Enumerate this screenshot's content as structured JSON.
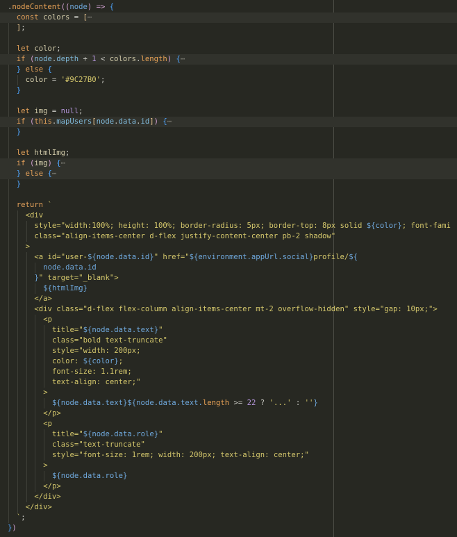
{
  "editor": {
    "lines": [
      {
        "indent": 0,
        "hl": false,
        "tokens": [
          {
            "t": ".",
            "c": "punc"
          },
          {
            "t": "nodeContent",
            "c": "fn"
          },
          {
            "t": "((",
            "c": "paren"
          },
          {
            "t": "node",
            "c": "param"
          },
          {
            "t": ") => ",
            "c": "paren"
          },
          {
            "t": "{",
            "c": "brace"
          }
        ]
      },
      {
        "indent": 1,
        "hl": true,
        "tokens": [
          {
            "t": "const ",
            "c": "kw"
          },
          {
            "t": "colors",
            "c": "var"
          },
          {
            "t": " = ",
            "c": "op"
          },
          {
            "t": "[",
            "c": "bracket"
          },
          {
            "t": "⋯",
            "c": "fold"
          }
        ]
      },
      {
        "indent": 1,
        "hl": false,
        "tokens": [
          {
            "t": "]",
            "c": "bracket"
          },
          {
            "t": ";",
            "c": "punc"
          }
        ]
      },
      {
        "indent": 1,
        "hl": false,
        "tokens": []
      },
      {
        "indent": 1,
        "hl": false,
        "tokens": [
          {
            "t": "let ",
            "c": "kw"
          },
          {
            "t": "color",
            "c": "var"
          },
          {
            "t": ";",
            "c": "punc"
          }
        ]
      },
      {
        "indent": 1,
        "hl": true,
        "tokens": [
          {
            "t": "if ",
            "c": "kw"
          },
          {
            "t": "(",
            "c": "paren"
          },
          {
            "t": "node",
            "c": "prop"
          },
          {
            "t": ".",
            "c": "punc"
          },
          {
            "t": "depth",
            "c": "prop"
          },
          {
            "t": " + ",
            "c": "op"
          },
          {
            "t": "1",
            "c": "num"
          },
          {
            "t": " < ",
            "c": "op"
          },
          {
            "t": "colors",
            "c": "var"
          },
          {
            "t": ".",
            "c": "punc"
          },
          {
            "t": "length",
            "c": "fn"
          },
          {
            "t": ") ",
            "c": "paren"
          },
          {
            "t": "{",
            "c": "brace"
          },
          {
            "t": "⋯",
            "c": "fold"
          }
        ]
      },
      {
        "indent": 1,
        "hl": false,
        "tokens": [
          {
            "t": "} ",
            "c": "brace"
          },
          {
            "t": "else ",
            "c": "kw"
          },
          {
            "t": "{",
            "c": "brace"
          }
        ]
      },
      {
        "indent": 2,
        "hl": false,
        "tokens": [
          {
            "t": "color",
            "c": "var"
          },
          {
            "t": " = ",
            "c": "op"
          },
          {
            "t": "'#9C27B0'",
            "c": "str"
          },
          {
            "t": ";",
            "c": "punc"
          }
        ]
      },
      {
        "indent": 1,
        "hl": false,
        "tokens": [
          {
            "t": "}",
            "c": "brace"
          }
        ]
      },
      {
        "indent": 1,
        "hl": false,
        "tokens": []
      },
      {
        "indent": 1,
        "hl": false,
        "tokens": [
          {
            "t": "let ",
            "c": "kw"
          },
          {
            "t": "img",
            "c": "var"
          },
          {
            "t": " = ",
            "c": "op"
          },
          {
            "t": "null",
            "c": "num"
          },
          {
            "t": ";",
            "c": "punc"
          }
        ]
      },
      {
        "indent": 1,
        "hl": true,
        "tokens": [
          {
            "t": "if ",
            "c": "kw"
          },
          {
            "t": "(",
            "c": "paren"
          },
          {
            "t": "this",
            "c": "kw"
          },
          {
            "t": ".",
            "c": "punc"
          },
          {
            "t": "mapUsers",
            "c": "prop"
          },
          {
            "t": "[",
            "c": "bracket"
          },
          {
            "t": "node",
            "c": "prop"
          },
          {
            "t": ".",
            "c": "punc"
          },
          {
            "t": "data",
            "c": "prop"
          },
          {
            "t": ".",
            "c": "punc"
          },
          {
            "t": "id",
            "c": "prop"
          },
          {
            "t": "]",
            "c": "bracket"
          },
          {
            "t": ") ",
            "c": "paren"
          },
          {
            "t": "{",
            "c": "brace"
          },
          {
            "t": "⋯",
            "c": "fold"
          }
        ]
      },
      {
        "indent": 1,
        "hl": false,
        "tokens": [
          {
            "t": "}",
            "c": "brace"
          }
        ]
      },
      {
        "indent": 1,
        "hl": false,
        "tokens": []
      },
      {
        "indent": 1,
        "hl": false,
        "tokens": [
          {
            "t": "let ",
            "c": "kw"
          },
          {
            "t": "htmlImg",
            "c": "var"
          },
          {
            "t": ";",
            "c": "punc"
          }
        ]
      },
      {
        "indent": 1,
        "hl": true,
        "tokens": [
          {
            "t": "if ",
            "c": "kw"
          },
          {
            "t": "(",
            "c": "paren"
          },
          {
            "t": "img",
            "c": "var"
          },
          {
            "t": ") ",
            "c": "paren"
          },
          {
            "t": "{",
            "c": "brace"
          },
          {
            "t": "⋯",
            "c": "fold"
          }
        ]
      },
      {
        "indent": 1,
        "hl": true,
        "tokens": [
          {
            "t": "} ",
            "c": "brace"
          },
          {
            "t": "else ",
            "c": "kw"
          },
          {
            "t": "{",
            "c": "brace"
          },
          {
            "t": "⋯",
            "c": "fold"
          }
        ]
      },
      {
        "indent": 1,
        "hl": false,
        "tokens": [
          {
            "t": "}",
            "c": "brace"
          }
        ]
      },
      {
        "indent": 1,
        "hl": false,
        "tokens": []
      },
      {
        "indent": 1,
        "hl": false,
        "tokens": [
          {
            "t": "return ",
            "c": "kw"
          },
          {
            "t": "`",
            "c": "str"
          }
        ]
      },
      {
        "indent": 2,
        "hl": false,
        "tokens": [
          {
            "t": "<div",
            "c": "str"
          }
        ]
      },
      {
        "indent": 3,
        "hl": false,
        "tokens": [
          {
            "t": "style=\"width:100%; height: 100%; border-radius: 5px; border-top: 8px solid ",
            "c": "str"
          },
          {
            "t": "${color}",
            "c": "interp"
          },
          {
            "t": "; font-fami",
            "c": "str"
          }
        ]
      },
      {
        "indent": 3,
        "hl": false,
        "tokens": [
          {
            "t": "class=\"align-items-center d-flex justify-content-center pb-2 shadow\"",
            "c": "str"
          }
        ]
      },
      {
        "indent": 2,
        "hl": false,
        "tokens": [
          {
            "t": ">",
            "c": "str"
          }
        ]
      },
      {
        "indent": 3,
        "hl": false,
        "tokens": [
          {
            "t": "<a id=\"user-",
            "c": "str"
          },
          {
            "t": "${node.data.id}",
            "c": "interp"
          },
          {
            "t": "\" href=\"",
            "c": "str"
          },
          {
            "t": "${environment.appUrl.social}",
            "c": "interp"
          },
          {
            "t": "profile/",
            "c": "str"
          },
          {
            "t": "${",
            "c": "interp"
          }
        ]
      },
      {
        "indent": 4,
        "hl": false,
        "tokens": [
          {
            "t": "node.data.id",
            "c": "interp"
          }
        ]
      },
      {
        "indent": 3,
        "hl": false,
        "tokens": [
          {
            "t": "}",
            "c": "interp"
          },
          {
            "t": "\" target=\"_blank\">",
            "c": "str"
          }
        ]
      },
      {
        "indent": 4,
        "hl": false,
        "tokens": [
          {
            "t": "${htmlImg}",
            "c": "interp"
          }
        ]
      },
      {
        "indent": 3,
        "hl": false,
        "tokens": [
          {
            "t": "</a>",
            "c": "str"
          }
        ]
      },
      {
        "indent": 3,
        "hl": false,
        "tokens": [
          {
            "t": "<div class=\"d-flex flex-column align-items-center mt-2 overflow-hidden\" style=\"gap: 10px;\">",
            "c": "str"
          }
        ]
      },
      {
        "indent": 4,
        "hl": false,
        "tokens": [
          {
            "t": "<p",
            "c": "str"
          }
        ]
      },
      {
        "indent": 5,
        "hl": false,
        "tokens": [
          {
            "t": "title=\"",
            "c": "str"
          },
          {
            "t": "${node.data.text}",
            "c": "interp"
          },
          {
            "t": "\"",
            "c": "str"
          }
        ]
      },
      {
        "indent": 5,
        "hl": false,
        "tokens": [
          {
            "t": "class=\"bold text-truncate\"",
            "c": "str"
          }
        ]
      },
      {
        "indent": 5,
        "hl": false,
        "tokens": [
          {
            "t": "style=\"width: 200px;",
            "c": "str"
          }
        ]
      },
      {
        "indent": 5,
        "hl": false,
        "tokens": [
          {
            "t": "color: ",
            "c": "str"
          },
          {
            "t": "${color}",
            "c": "interp"
          },
          {
            "t": ";",
            "c": "str"
          }
        ]
      },
      {
        "indent": 5,
        "hl": false,
        "tokens": [
          {
            "t": "font-size: 1.1rem;",
            "c": "str"
          }
        ]
      },
      {
        "indent": 5,
        "hl": false,
        "tokens": [
          {
            "t": "text-align: center;\"",
            "c": "str"
          }
        ]
      },
      {
        "indent": 4,
        "hl": false,
        "tokens": [
          {
            "t": ">",
            "c": "str"
          }
        ]
      },
      {
        "indent": 5,
        "hl": false,
        "tokens": [
          {
            "t": "${node.data.text}${node.data.text.",
            "c": "interp"
          },
          {
            "t": "length",
            "c": "fn"
          },
          {
            "t": " >= ",
            "c": "op"
          },
          {
            "t": "22",
            "c": "num"
          },
          {
            "t": " ? ",
            "c": "op"
          },
          {
            "t": "'...'",
            "c": "str"
          },
          {
            "t": " : ",
            "c": "op"
          },
          {
            "t": "''",
            "c": "str"
          },
          {
            "t": "}",
            "c": "interp"
          }
        ]
      },
      {
        "indent": 4,
        "hl": false,
        "tokens": [
          {
            "t": "</p>",
            "c": "str"
          }
        ]
      },
      {
        "indent": 4,
        "hl": false,
        "tokens": [
          {
            "t": "<p",
            "c": "str"
          }
        ]
      },
      {
        "indent": 5,
        "hl": false,
        "tokens": [
          {
            "t": "title=\"",
            "c": "str"
          },
          {
            "t": "${node.data.role}",
            "c": "interp"
          },
          {
            "t": "\"",
            "c": "str"
          }
        ]
      },
      {
        "indent": 5,
        "hl": false,
        "tokens": [
          {
            "t": "class=\"text-truncate\"",
            "c": "str"
          }
        ]
      },
      {
        "indent": 5,
        "hl": false,
        "tokens": [
          {
            "t": "style=\"font-size: 1rem; width: 200px; text-align: center;\"",
            "c": "str"
          }
        ]
      },
      {
        "indent": 4,
        "hl": false,
        "tokens": [
          {
            "t": ">",
            "c": "str"
          }
        ]
      },
      {
        "indent": 5,
        "hl": false,
        "tokens": [
          {
            "t": "${node.data.role}",
            "c": "interp"
          }
        ]
      },
      {
        "indent": 4,
        "hl": false,
        "tokens": [
          {
            "t": "</p>",
            "c": "str"
          }
        ]
      },
      {
        "indent": 3,
        "hl": false,
        "tokens": [
          {
            "t": "</div>",
            "c": "str"
          }
        ]
      },
      {
        "indent": 2,
        "hl": false,
        "tokens": [
          {
            "t": "</div>",
            "c": "str"
          }
        ]
      },
      {
        "indent": 1,
        "hl": false,
        "tokens": [
          {
            "t": "`",
            "c": "str"
          },
          {
            "t": ";",
            "c": "punc"
          }
        ]
      },
      {
        "indent": 0,
        "hl": false,
        "tokens": [
          {
            "t": "}",
            "c": "brace"
          },
          {
            "t": ")",
            "c": "paren"
          }
        ]
      }
    ]
  }
}
